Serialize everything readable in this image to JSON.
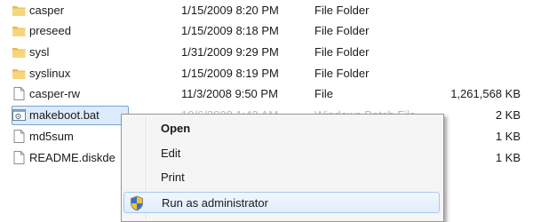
{
  "files": [
    {
      "name": "casper",
      "date": "1/15/2009 8:20 PM",
      "type": "File Folder",
      "size": "",
      "icon": "folder-icon"
    },
    {
      "name": "preseed",
      "date": "1/15/2009 8:18 PM",
      "type": "File Folder",
      "size": "",
      "icon": "folder-icon"
    },
    {
      "name": "sysl",
      "date": "1/31/2009 9:29 PM",
      "type": "File Folder",
      "size": "",
      "icon": "folder-icon"
    },
    {
      "name": "syslinux",
      "date": "1/15/2009 8:19 PM",
      "type": "File Folder",
      "size": "",
      "icon": "folder-icon"
    },
    {
      "name": "casper-rw",
      "date": "11/3/2008 9:50 PM",
      "type": "File",
      "size": "1,261,568 KB",
      "icon": "blank-file-icon"
    },
    {
      "name": "makeboot.bat",
      "date": "10/6/2008 1:43 AM",
      "type": "Windows Batch File",
      "size": "2 KB",
      "icon": "batch-file-icon"
    },
    {
      "name": "md5sum",
      "date": "",
      "type": "",
      "size": "1 KB",
      "icon": "blank-file-icon"
    },
    {
      "name": "README.diskde",
      "date": "",
      "type": "",
      "size": "1 KB",
      "icon": "blank-file-icon"
    }
  ],
  "context_menu": {
    "items": [
      {
        "label": "Open",
        "icon": ""
      },
      {
        "label": "Edit",
        "icon": ""
      },
      {
        "label": "Print",
        "icon": ""
      },
      {
        "label": "Run as administrator",
        "icon": "uac-shield-icon"
      }
    ]
  },
  "colors": {
    "selection": "#dcebfc",
    "selection_border": "#7da2ce",
    "folder": "#f0c75a",
    "menu_background": "#f5f5f5"
  }
}
